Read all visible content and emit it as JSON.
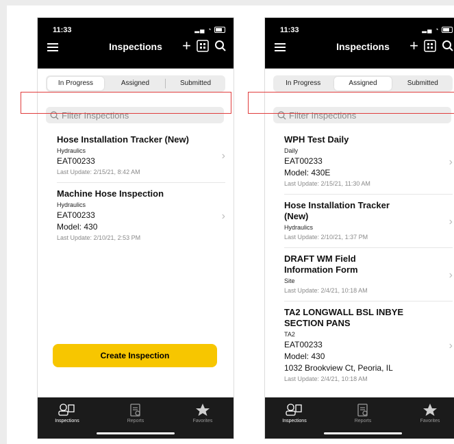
{
  "phones": [
    {
      "status_time": "11:33",
      "nav_title": "Inspections",
      "tabs": [
        "In Progress",
        "Assigned",
        "Submitted"
      ],
      "active_tab": "In Progress",
      "filter_placeholder": "Filter Inspections",
      "items": [
        {
          "title": "Hose Installation Tracker (New)",
          "category": "Hydraulics",
          "asset": "EAT00233",
          "model": "",
          "address": "",
          "last_update": "Last Update: 2/15/21, 8:42 AM"
        },
        {
          "title": "Machine Hose Inspection",
          "category": "Hydraulics",
          "asset": "EAT00233",
          "model": "Model: 430",
          "address": "",
          "last_update": "Last Update: 2/10/21, 2:53 PM"
        }
      ],
      "create_button": "Create Inspection",
      "bottom_tabs": [
        "Inspections",
        "Reports",
        "Favorites"
      ]
    },
    {
      "status_time": "11:33",
      "nav_title": "Inspections",
      "tabs": [
        "In Progress",
        "Assigned",
        "Submitted"
      ],
      "active_tab": "Assigned",
      "filter_placeholder": "Filter Inspections",
      "items": [
        {
          "title": "WPH Test Daily",
          "category": "Daily",
          "asset": "EAT00233",
          "model": "Model: 430E",
          "address": "",
          "last_update": "Last Update: 2/15/21, 11:30 AM"
        },
        {
          "title": "Hose Installation Tracker (New)",
          "category": "Hydraulics",
          "asset": "",
          "model": "",
          "address": "",
          "last_update": "Last Update: 2/10/21, 1:37 PM"
        },
        {
          "title": "DRAFT WM Field Information Form",
          "category": "Site",
          "asset": "",
          "model": "",
          "address": "",
          "last_update": "Last Update: 2/4/21, 10:18 AM"
        },
        {
          "title": "TA2 LONGWALL BSL INBYE SECTION PANS",
          "category": "TA2",
          "asset": "EAT00233",
          "model": "Model: 430",
          "address": "1032 Brookview Ct, Peoria, IL",
          "last_update": "Last Update: 2/4/21, 10:18 AM"
        }
      ],
      "bottom_tabs": [
        "Inspections",
        "Reports",
        "Favorites"
      ]
    }
  ],
  "colors": {
    "accent": "#f7c600",
    "highlight": "#e03c3c",
    "bar": "#000000"
  }
}
